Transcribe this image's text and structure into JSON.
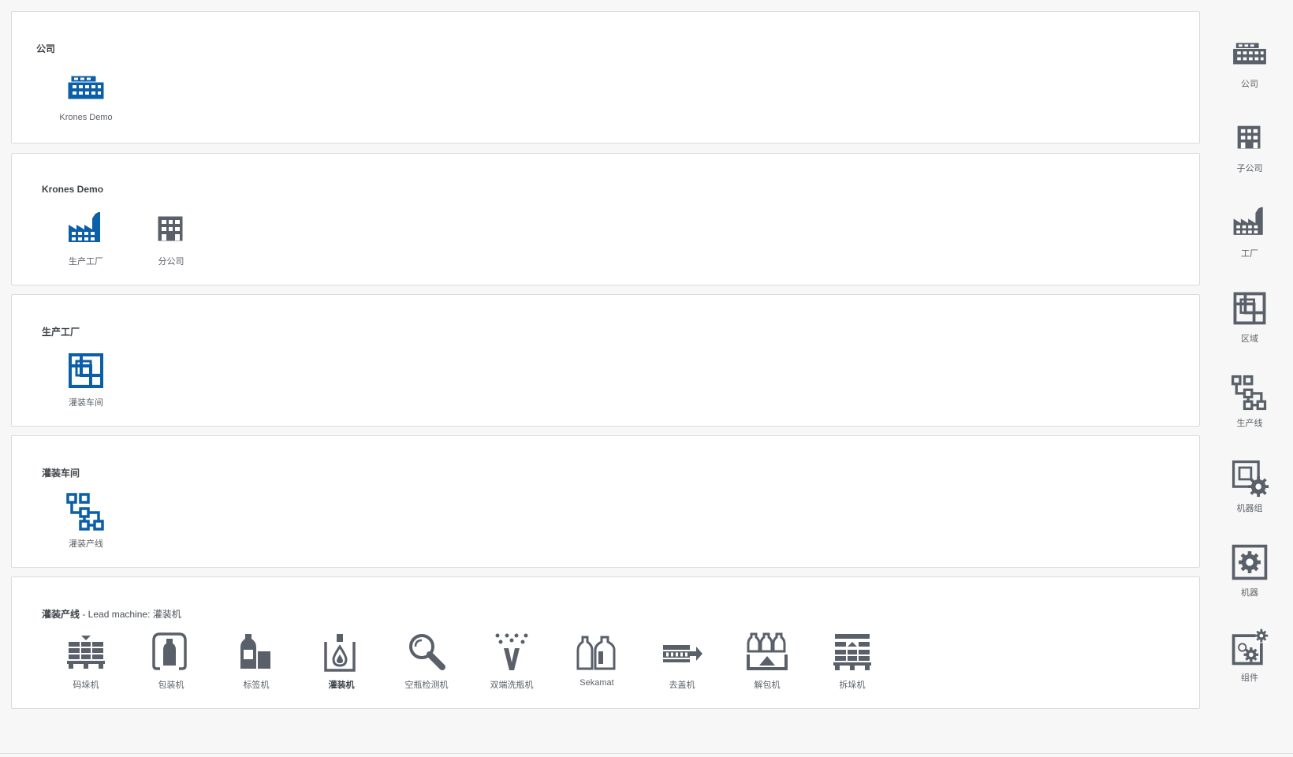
{
  "panels": [
    {
      "title": "公司",
      "subtitle": "",
      "items": [
        {
          "label": "Krones Demo",
          "icon": "company-icon",
          "color": "#0b5fa8"
        }
      ]
    },
    {
      "title": "Krones Demo",
      "subtitle": "",
      "items": [
        {
          "label": "生产工厂",
          "icon": "factory-icon",
          "color": "#0b5fa8"
        },
        {
          "label": "分公司",
          "icon": "subsidiary-icon",
          "color": "#5a606a"
        }
      ]
    },
    {
      "title": "生产工厂",
      "subtitle": "",
      "items": [
        {
          "label": "灌装车间",
          "icon": "area-icon",
          "color": "#0b5fa8"
        }
      ]
    },
    {
      "title": "灌装车间",
      "subtitle": "",
      "items": [
        {
          "label": "灌装产线",
          "icon": "production-line-icon",
          "color": "#0b5fa8"
        }
      ]
    },
    {
      "title": "灌装产线",
      "subtitle": " - Lead machine: 灌装机",
      "items": [
        {
          "label": "码垛机",
          "icon": "palletizer-icon",
          "color": "#5a606a"
        },
        {
          "label": "包装机",
          "icon": "packer-icon",
          "color": "#5a606a"
        },
        {
          "label": "标签机",
          "icon": "labeler-icon",
          "color": "#5a606a"
        },
        {
          "label": "灌装机",
          "icon": "filler-icon",
          "color": "#5a606a",
          "bold": true
        },
        {
          "label": "空瓶检测机",
          "icon": "inspector-icon",
          "color": "#5a606a"
        },
        {
          "label": "双端洗瓶机",
          "icon": "washer-icon",
          "color": "#5a606a"
        },
        {
          "label": "Sekamat",
          "icon": "sekamat-icon",
          "color": "#5a606a"
        },
        {
          "label": "去盖机",
          "icon": "decapper-icon",
          "color": "#5a606a"
        },
        {
          "label": "解包机",
          "icon": "unpacker-icon",
          "color": "#5a606a"
        },
        {
          "label": "拆垛机",
          "icon": "depalletizer-icon",
          "color": "#5a606a"
        }
      ]
    }
  ],
  "sidebar": {
    "items": [
      {
        "label": "公司",
        "icon": "company-icon"
      },
      {
        "label": "子公司",
        "icon": "subsidiary-icon"
      },
      {
        "label": "工厂",
        "icon": "factory-icon"
      },
      {
        "label": "区域",
        "icon": "area-icon"
      },
      {
        "label": "生产线",
        "icon": "production-line-icon"
      },
      {
        "label": "机器组",
        "icon": "machine-group-icon"
      },
      {
        "label": "机器",
        "icon": "machine-icon"
      },
      {
        "label": "组件",
        "icon": "component-icon"
      }
    ]
  }
}
